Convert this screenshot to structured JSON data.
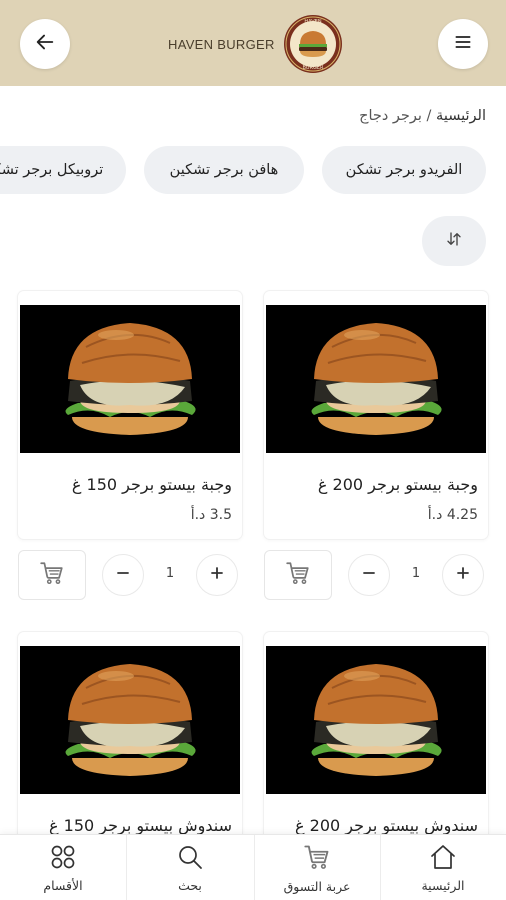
{
  "header": {
    "brand_name": "HAVEN BURGER",
    "logo_top_text": "HAVEN",
    "logo_bottom_text": "BURGER",
    "back_icon": "arrow-left-icon",
    "menu_icon": "hamburger-menu-icon",
    "background": "#dfd3b6"
  },
  "breadcrumb": {
    "home": "الرئيسية",
    "separator": " / ",
    "current": "برجر دجاج"
  },
  "categories": [
    {
      "label": "الفريدو برجر تشكن"
    },
    {
      "label": "هافن برجر تشكين"
    },
    {
      "label": "تروبيكل برجر تشكن"
    }
  ],
  "sort": {
    "icon": "sort-arrows-icon"
  },
  "products": [
    {
      "title": "وجبة بيستو برجر 200 غ",
      "price": "4.25 د.أ",
      "quantity": "1"
    },
    {
      "title": "وجبة بيستو برجر 150 غ",
      "price": "3.5 د.أ",
      "quantity": "1"
    },
    {
      "title": "سندوش بيستو برجر 200 غ",
      "price": "",
      "quantity": ""
    },
    {
      "title": "سندوش بيستو برجر 150 غ",
      "price": "",
      "quantity": ""
    }
  ],
  "bottom_nav": [
    {
      "label": "الرئيسية",
      "icon": "home-icon"
    },
    {
      "label": "عربة التسوق",
      "icon": "cart-icon"
    },
    {
      "label": "بحث",
      "icon": "search-icon"
    },
    {
      "label": "الأقسام",
      "icon": "grid-circles-icon"
    }
  ]
}
